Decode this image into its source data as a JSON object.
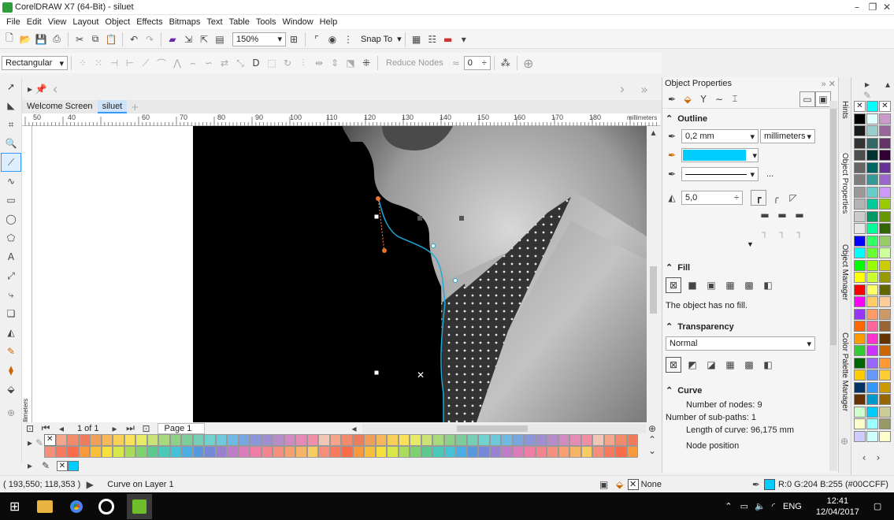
{
  "app": {
    "title": "CorelDRAW X7 (64-Bit) - siluet"
  },
  "menu": [
    "File",
    "Edit",
    "View",
    "Layout",
    "Object",
    "Effects",
    "Bitmaps",
    "Text",
    "Table",
    "Tools",
    "Window",
    "Help"
  ],
  "toolbar": {
    "zoom": "150%",
    "snap_to": "Snap To"
  },
  "property_bar": {
    "selection_mode": "Rectangular",
    "reduce_nodes": "Reduce Nodes",
    "smoothness": "0"
  },
  "document_tabs": [
    "Welcome Screen",
    "siluet"
  ],
  "ruler": {
    "h_ticks": [
      "50",
      "40",
      "60",
      "70",
      "80",
      "90",
      "100",
      "110",
      "120",
      "130",
      "140",
      "150",
      "160",
      "170",
      "180"
    ],
    "units": "millimeters",
    "v_label": "millimeters"
  },
  "page_nav": {
    "counter": "1 of 1",
    "page_tab": "Page 1"
  },
  "status": {
    "coords": "( 193,550; 118,353 )",
    "object_info": "Curve on Layer 1",
    "fill_status": "None",
    "outline_status": "R:0 G:204 B:255 (#00CCFF)"
  },
  "docker": {
    "title": "Object Properties",
    "outline": {
      "heading": "Outline",
      "width": "0,2 mm",
      "units": "millimeters",
      "color": "#00CCFF",
      "miter": "5,0",
      "more": "..."
    },
    "fill": {
      "heading": "Fill",
      "message": "The object has no fill."
    },
    "transparency": {
      "heading": "Transparency",
      "mode": "Normal"
    },
    "curve": {
      "heading": "Curve",
      "nodes_label": "Number of nodes:",
      "nodes": "9",
      "subpaths_label": "Number of sub-paths:",
      "subpaths": "1",
      "length_label": "Length of curve:",
      "length": "96,175 mm",
      "node_position": "Node position"
    }
  },
  "side_tabs": [
    "Hints",
    "Object Properties",
    "Object Manager",
    "Color Palette Manager"
  ],
  "taskbar": {
    "lang": "ENG",
    "time": "12:41",
    "date": "12/04/2017"
  },
  "colors": {
    "accent": "#00CCFF",
    "outline_curve": "#1fa8d6"
  }
}
